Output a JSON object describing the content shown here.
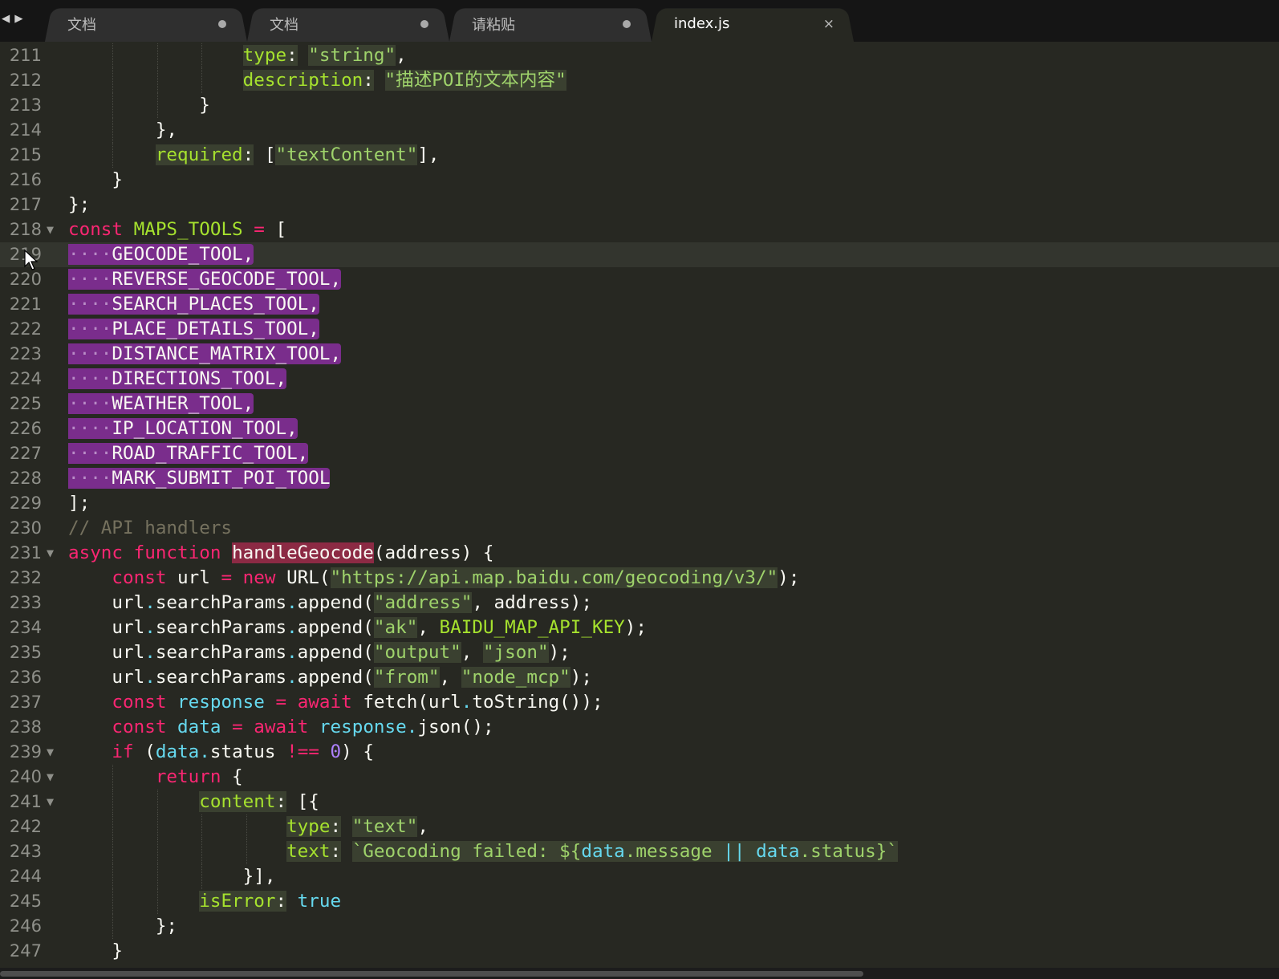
{
  "tabs": [
    {
      "label": "文档",
      "state": "modified",
      "active": false
    },
    {
      "label": "文档",
      "state": "modified",
      "active": false
    },
    {
      "label": "请粘贴",
      "state": "modified",
      "active": false
    },
    {
      "label": "index.js",
      "state": "close",
      "active": true
    }
  ],
  "icons": {
    "back": "◀",
    "forward": "▶",
    "close": "×",
    "fold": "▼"
  },
  "lines": [
    {
      "n": "211",
      "text": "                type: \"string\","
    },
    {
      "n": "212",
      "text": "                description: \"描述POI的文本内容\""
    },
    {
      "n": "213",
      "text": "            }"
    },
    {
      "n": "214",
      "text": "        },"
    },
    {
      "n": "215",
      "text": "        required: [\"textContent\"],"
    },
    {
      "n": "216",
      "text": "    }"
    },
    {
      "n": "217",
      "text": "};"
    },
    {
      "n": "218",
      "text": "const MAPS_TOOLS = [",
      "fold": true
    },
    {
      "n": "219",
      "text": "    GEOCODE_TOOL,",
      "selected": true,
      "current": true
    },
    {
      "n": "220",
      "text": "    REVERSE_GEOCODE_TOOL,",
      "selected": true
    },
    {
      "n": "221",
      "text": "    SEARCH_PLACES_TOOL,",
      "selected": true
    },
    {
      "n": "222",
      "text": "    PLACE_DETAILS_TOOL,",
      "selected": true
    },
    {
      "n": "223",
      "text": "    DISTANCE_MATRIX_TOOL,",
      "selected": true
    },
    {
      "n": "224",
      "text": "    DIRECTIONS_TOOL,",
      "selected": true
    },
    {
      "n": "225",
      "text": "    WEATHER_TOOL,",
      "selected": true
    },
    {
      "n": "226",
      "text": "    IP_LOCATION_TOOL,",
      "selected": true
    },
    {
      "n": "227",
      "text": "    ROAD_TRAFFIC_TOOL,",
      "selected": true
    },
    {
      "n": "228",
      "text": "    MARK_SUBMIT_POI_TOOL",
      "selected": true
    },
    {
      "n": "229",
      "text": "];"
    },
    {
      "n": "230",
      "text": "// API handlers"
    },
    {
      "n": "231",
      "text": "async function handleGeocode(address) {",
      "fold": true
    },
    {
      "n": "232",
      "text": "    const url = new URL(\"https://api.map.baidu.com/geocoding/v3/\");"
    },
    {
      "n": "233",
      "text": "    url.searchParams.append(\"address\", address);"
    },
    {
      "n": "234",
      "text": "    url.searchParams.append(\"ak\", BAIDU_MAP_API_KEY);"
    },
    {
      "n": "235",
      "text": "    url.searchParams.append(\"output\", \"json\");"
    },
    {
      "n": "236",
      "text": "    url.searchParams.append(\"from\", \"node_mcp\");"
    },
    {
      "n": "237",
      "text": "    const response = await fetch(url.toString());"
    },
    {
      "n": "238",
      "text": "    const data = await response.json();"
    },
    {
      "n": "239",
      "text": "    if (data.status !== 0) {",
      "fold": true
    },
    {
      "n": "240",
      "text": "        return {",
      "fold": true
    },
    {
      "n": "241",
      "text": "            content: [{",
      "fold": true
    },
    {
      "n": "242",
      "text": "                    type: \"text\","
    },
    {
      "n": "243",
      "text": "                    text: `Geocoding failed: ${data.message || data.status}`"
    },
    {
      "n": "244",
      "text": "                }],"
    },
    {
      "n": "245",
      "text": "            isError: true"
    },
    {
      "n": "246",
      "text": "        };"
    },
    {
      "n": "247",
      "text": "    }"
    }
  ],
  "colors": {
    "background": "#272822",
    "selection": "#7a2d8c",
    "keyword": "#f92672",
    "string": "#9fd36b",
    "identifier": "#a6e22e",
    "comment": "#75715e",
    "builtin": "#66d9ef"
  }
}
